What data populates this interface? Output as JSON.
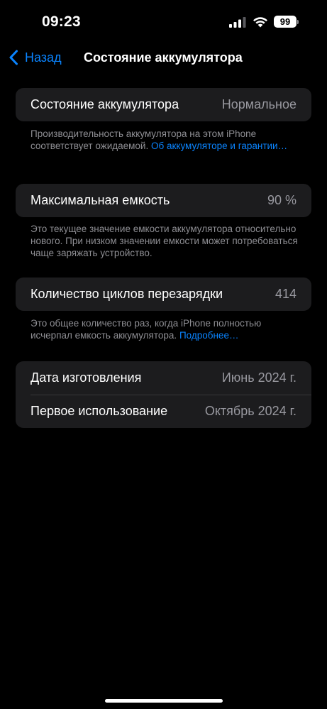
{
  "status_bar": {
    "time": "09:23",
    "battery_level": "99",
    "icons": [
      "cellular-signal-icon",
      "wifi-icon",
      "battery-icon"
    ]
  },
  "nav": {
    "back_label": "Назад",
    "back_icon": "chevron-left-icon",
    "title": "Состояние аккумулятора"
  },
  "battery_state": {
    "label": "Состояние аккумулятора",
    "value": "Нормальное",
    "footnote_text": "Производительность аккумулятора на этом iPhone соответствует ожидаемой.",
    "footnote_link": "Об аккумуляторе и гарантии…"
  },
  "max_capacity": {
    "label": "Максимальная емкость",
    "value": "90 %",
    "footnote_text": "Это текущее значение емкости аккумулятора относительно нового. При низком значении емкости может потребоваться чаще заряжать устройство."
  },
  "cycle_count": {
    "label": "Количество циклов перезарядки",
    "value": "414",
    "footnote_text": "Это общее количество раз, когда iPhone полностью исчерпал емкость аккумулятора.",
    "footnote_link": "Подробнее…"
  },
  "dates": {
    "manufacture_label": "Дата изготовления",
    "manufacture_value": "Июнь 2024 г.",
    "first_use_label": "Первое использование",
    "first_use_value": "Октябрь 2024 г."
  },
  "colors": {
    "background": "#000000",
    "group_background": "#1c1c1e",
    "accent": "#0a84ff",
    "secondary_text": "#8e8e93"
  }
}
